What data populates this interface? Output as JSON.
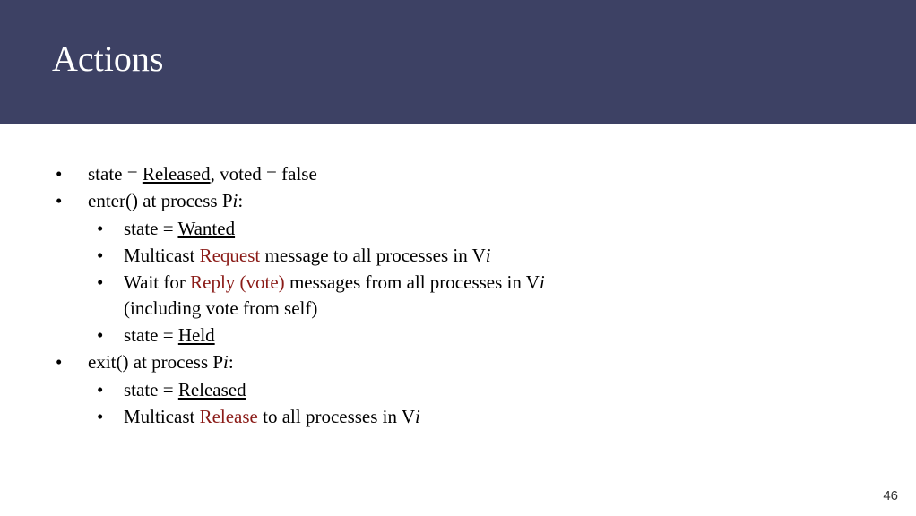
{
  "slide": {
    "title": "Actions",
    "page_number": "46"
  },
  "b": "•",
  "t": {
    "l1a": "state = ",
    "l1b": "Released",
    "l1c": ", voted = false",
    "l2a": "enter() at process P",
    "l2i": "i",
    "l2b": ":",
    "l2_1a": "state = ",
    "l2_1b": "Wanted",
    "l2_2a": "Multicast ",
    "l2_2b": "Request",
    "l2_2c": " message to all processes in V",
    "l2_2i": "i",
    "l2_3a": "Wait for ",
    "l2_3b": "Reply (vote)",
    "l2_3c": " messages from all processes in V",
    "l2_3i": "i",
    "l2_3d": " (including vote from self)",
    "l2_4a": "state = ",
    "l2_4b": "Held",
    "l3a": "exit() at process P",
    "l3i": "i",
    "l3b": ":",
    "l3_1a": "state = ",
    "l3_1b": "Released",
    "l3_2a": "Multicast ",
    "l3_2b": "Release",
    "l3_2c": " to all processes in V",
    "l3_2i": "i"
  }
}
